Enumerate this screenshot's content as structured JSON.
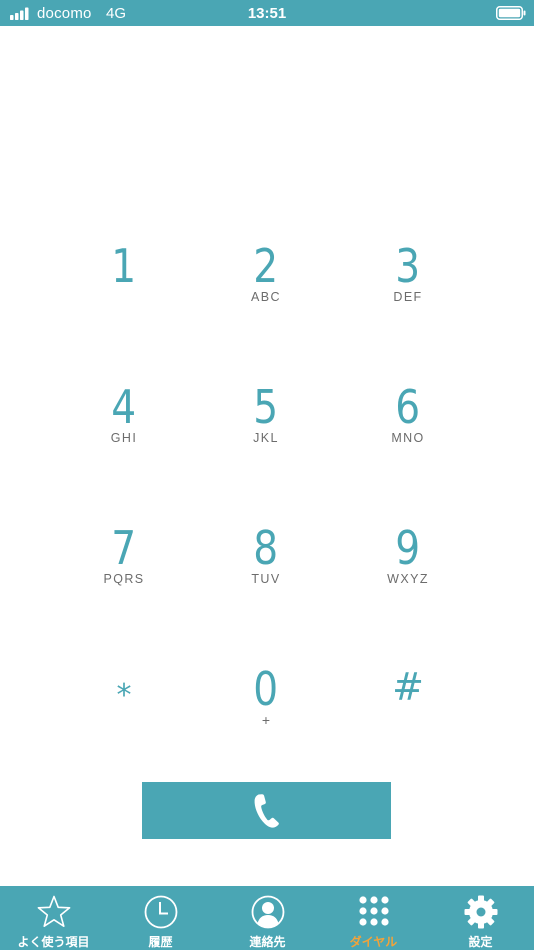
{
  "status_bar": {
    "carrier": "docomo",
    "network": "4G",
    "time": "13:51"
  },
  "keypad": {
    "keys": [
      {
        "digit": "1",
        "letters": ""
      },
      {
        "digit": "2",
        "letters": "ABC"
      },
      {
        "digit": "3",
        "letters": "DEF"
      },
      {
        "digit": "4",
        "letters": "GHI"
      },
      {
        "digit": "5",
        "letters": "JKL"
      },
      {
        "digit": "6",
        "letters": "MNO"
      },
      {
        "digit": "7",
        "letters": "PQRS"
      },
      {
        "digit": "8",
        "letters": "TUV"
      },
      {
        "digit": "9",
        "letters": "WXYZ"
      },
      {
        "digit": "*",
        "letters": ""
      },
      {
        "digit": "0",
        "letters": "+"
      },
      {
        "digit": "#",
        "letters": ""
      }
    ]
  },
  "call_button": {
    "icon": "phone-icon"
  },
  "tab_bar": {
    "tabs": [
      {
        "label": "よく使う項目",
        "icon": "star-icon",
        "active": false
      },
      {
        "label": "履歴",
        "icon": "clock-icon",
        "active": false
      },
      {
        "label": "連絡先",
        "icon": "contact-icon",
        "active": false
      },
      {
        "label": "ダイヤル",
        "icon": "keypad-icon",
        "active": true
      },
      {
        "label": "設定",
        "icon": "gear-icon",
        "active": false
      }
    ]
  },
  "colors": {
    "accent": "#4aa6b4",
    "active_tab": "#f2a33a",
    "letters": "#6c6c6c",
    "background": "#ffffff"
  }
}
